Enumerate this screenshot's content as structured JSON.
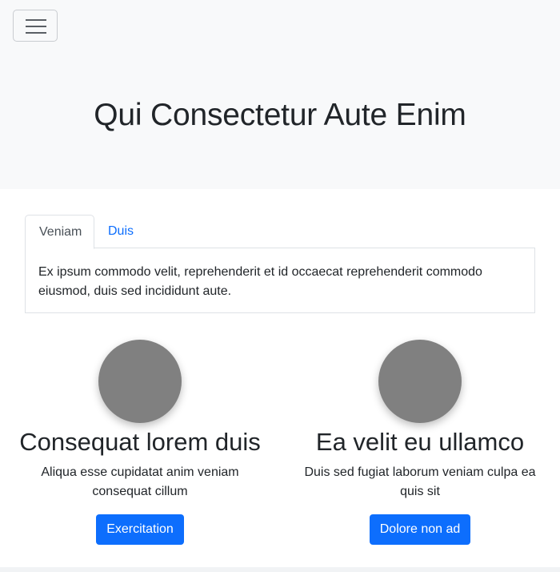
{
  "navbar": {
    "toggler_icon": "hamburger-menu-icon"
  },
  "hero": {
    "title": "Qui Consectetur Aute Enim"
  },
  "tabs": [
    {
      "label": "Veniam",
      "active": true
    },
    {
      "label": "Duis",
      "active": false
    }
  ],
  "tab_content": "Ex ipsum commodo velit, reprehenderit et id occaecat reprehenderit commodo eiusmod, duis sed incididunt aute.",
  "features": [
    {
      "heading": "Consequat lorem duis",
      "text": "Aliqua esse cupidatat anim veniam consequat cillum",
      "button": "Exercitation"
    },
    {
      "heading": "Ea velit eu ullamco",
      "text": "Duis sed fugiat laborum veniam culpa ea quis sit",
      "button": "Dolore non ad"
    }
  ],
  "colors": {
    "accent": "#0d6efd",
    "hero_bg": "#f8f9fa",
    "avatar": "#808080"
  }
}
